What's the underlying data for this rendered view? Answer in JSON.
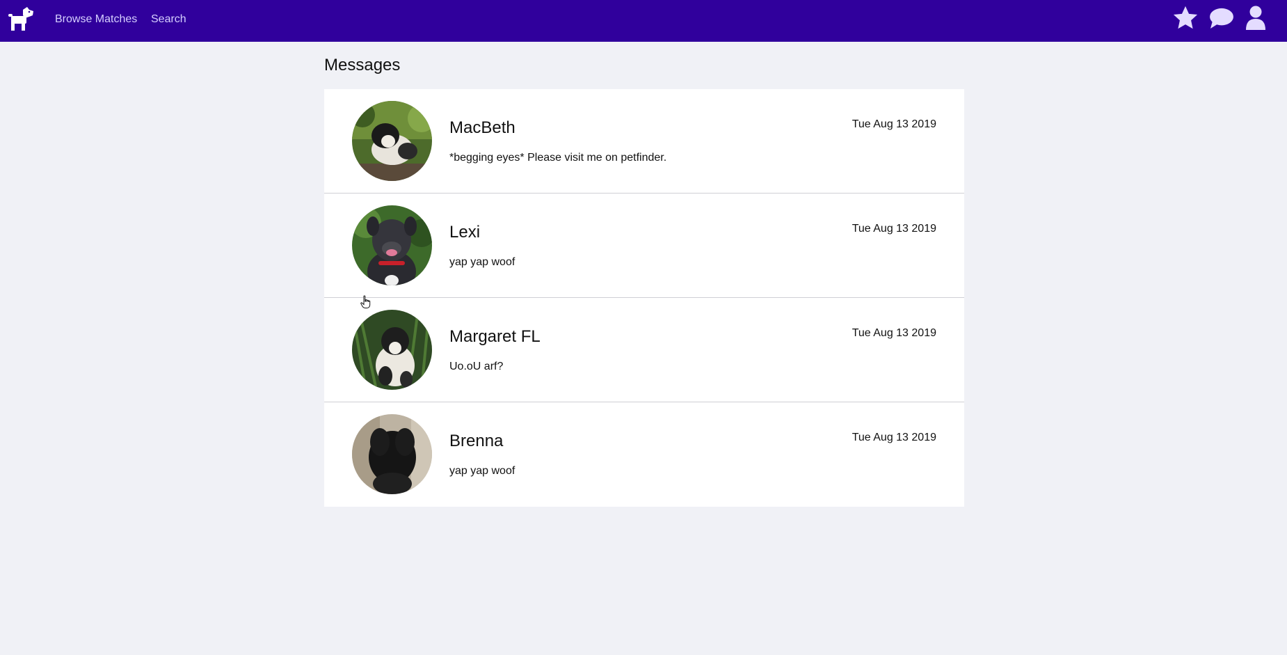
{
  "nav": {
    "logo_icon": "dog-icon",
    "links": [
      {
        "label": "Browse Matches"
      },
      {
        "label": "Search"
      }
    ],
    "right_icons": [
      "star-icon",
      "chat-bubble-icon",
      "user-icon"
    ],
    "color": "#30009c"
  },
  "page": {
    "title": "Messages"
  },
  "messages": [
    {
      "name": "MacBeth",
      "preview": "*begging eyes* Please visit me on petfinder.",
      "date": "Tue Aug 13 2019"
    },
    {
      "name": "Lexi",
      "preview": "yap yap woof",
      "date": "Tue Aug 13 2019"
    },
    {
      "name": "Margaret FL",
      "preview": "Uo.oU arf?",
      "date": "Tue Aug 13 2019"
    },
    {
      "name": "Brenna",
      "preview": "yap yap woof",
      "date": "Tue Aug 13 2019"
    }
  ]
}
